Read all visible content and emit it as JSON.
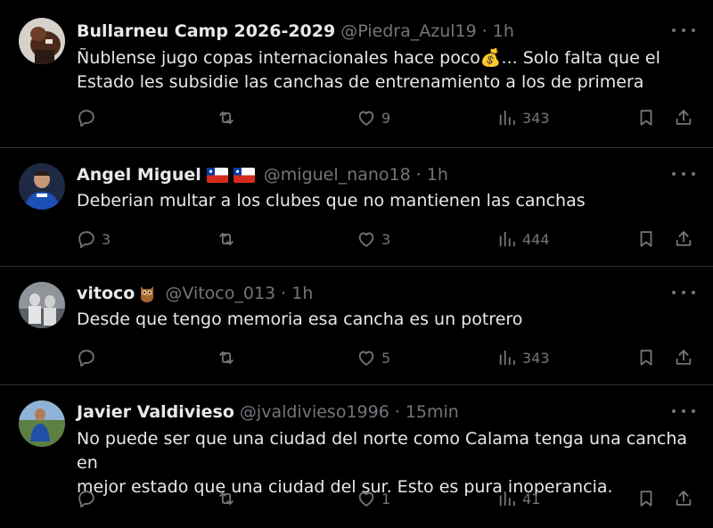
{
  "tweets": [
    {
      "name": "Bullarneu Camp 2026-2029",
      "handle": "@Piedra_Azul19",
      "time": "1h",
      "text_line1": "Ñublense jugo copas internacionales hace poco💰... Solo falta que el",
      "text_line2": "Estado les subsidie las canchas de entrenamiento a los de primera",
      "replies": "",
      "retweets": "",
      "likes": "9",
      "views": "343"
    },
    {
      "name": "Angel Miguel",
      "handle": "@miguel_nano18",
      "time": "1h",
      "text_line1": "Deberian multar a los clubes que no mantienen las canchas",
      "text_line2": "",
      "replies": "3",
      "retweets": "",
      "likes": "3",
      "views": "444"
    },
    {
      "name": "vitoco",
      "handle": "@Vitoco_013",
      "time": "1h",
      "text_line1": "Desde que tengo memoria esa cancha es un potrero",
      "text_line2": "",
      "replies": "",
      "retweets": "",
      "likes": "5",
      "views": "343"
    },
    {
      "name": "Javier Valdivieso",
      "handle": "@jvaldivieso1996",
      "time": "15min",
      "text_line1": "No puede ser que una ciudad del norte como Calama tenga una cancha en",
      "text_line2": "mejor estado que una ciudad del sur. Esto es pura inoperancia.",
      "replies": "",
      "retweets": "",
      "likes": "1",
      "views": "41"
    }
  ],
  "separator": "·",
  "colors": {
    "background": "#000000",
    "text": "#e7e9ea",
    "muted": "#71767b",
    "divider": "#2f3336"
  },
  "icons": [
    "reply-icon",
    "retweet-icon",
    "like-icon",
    "views-icon",
    "bookmark-icon",
    "share-icon",
    "more-icon"
  ]
}
